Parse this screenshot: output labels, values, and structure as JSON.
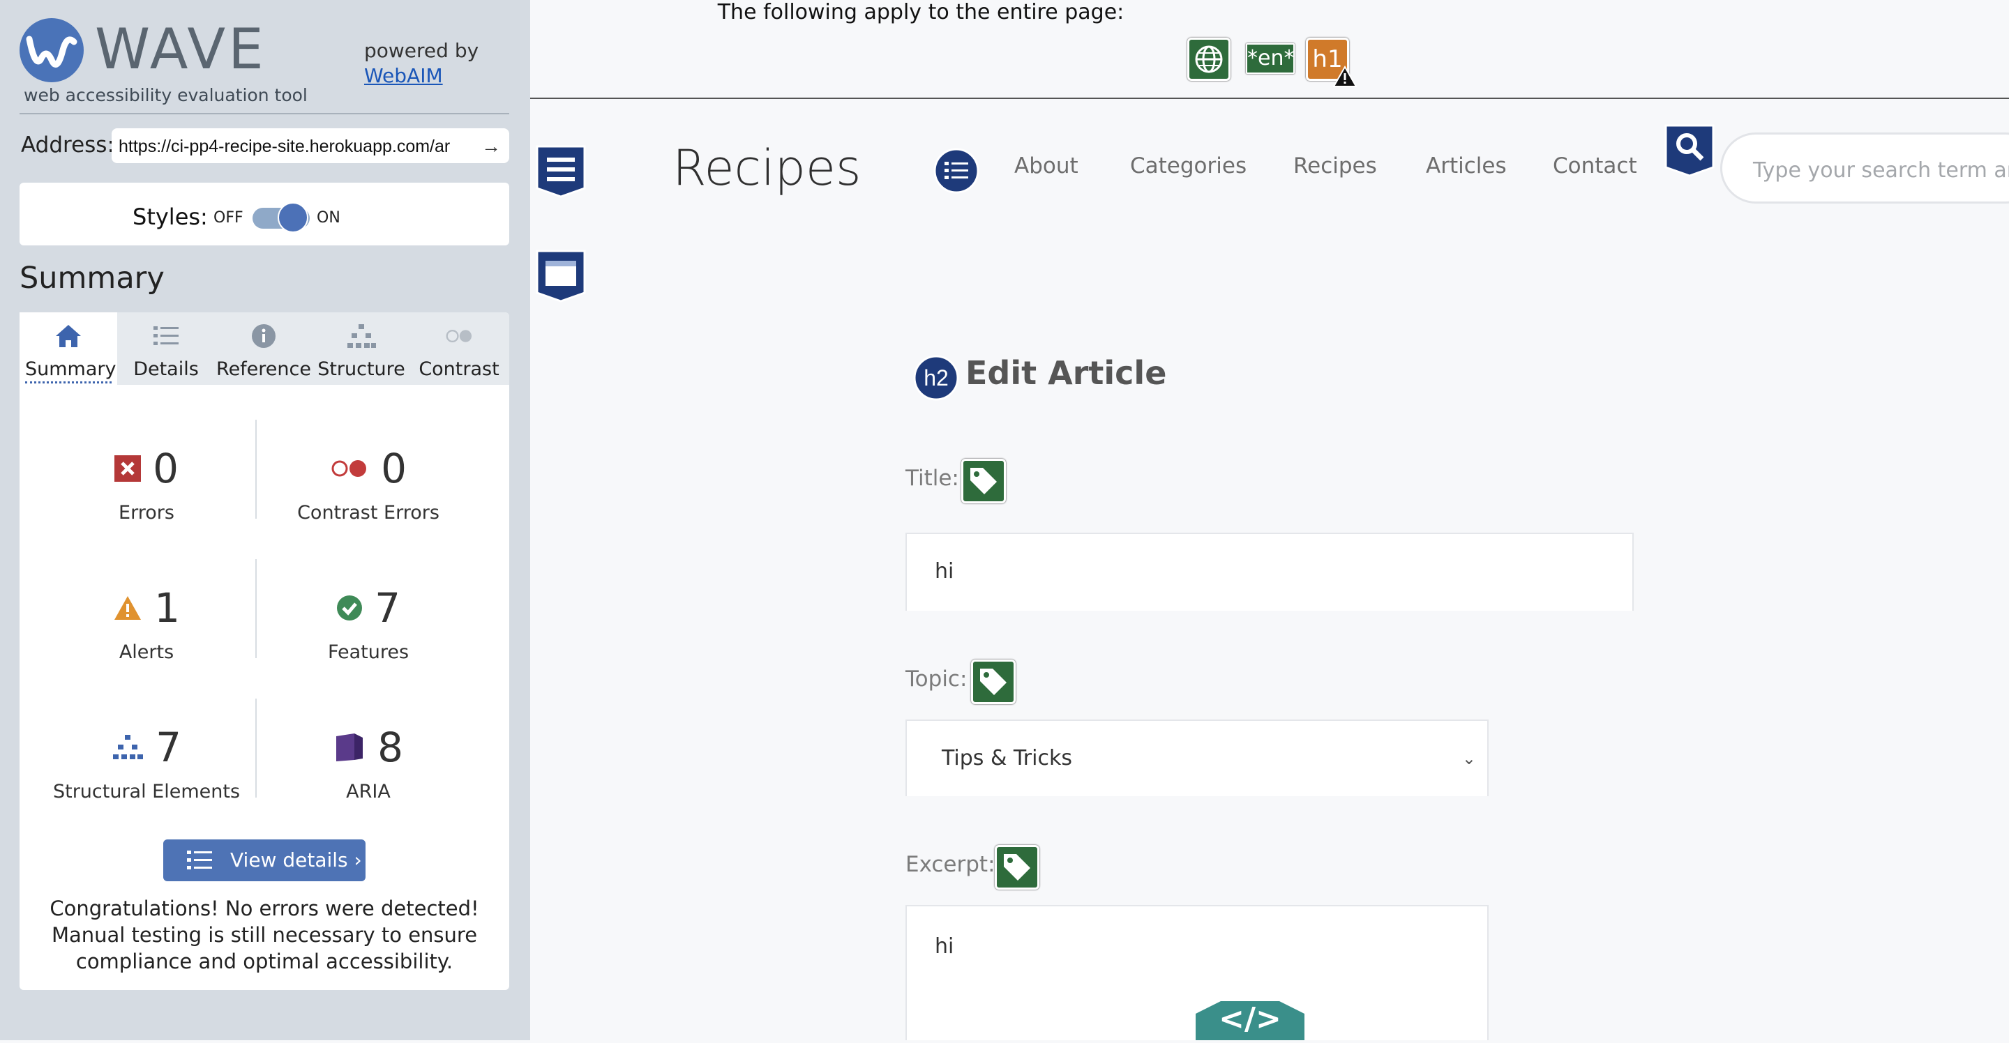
{
  "wave": {
    "logo_text": "WAVE",
    "subtitle": "web accessibility evaluation tool",
    "powered_by": "powered by",
    "webaim_link": "WebAIM",
    "address_label": "Address:",
    "address_value": "https://ci-pp4-recipe-site.herokuapp.com/ar",
    "styles_label": "Styles:",
    "styles_off": "OFF",
    "styles_on": "ON",
    "styles_toggle_state": "on",
    "summary_heading": "Summary",
    "tabs": [
      {
        "label": "Summary",
        "icon": "home-icon",
        "active": true
      },
      {
        "label": "Details",
        "icon": "list-icon",
        "active": false
      },
      {
        "label": "Reference",
        "icon": "info-icon",
        "active": false
      },
      {
        "label": "Structure",
        "icon": "hierarchy-icon",
        "active": false
      },
      {
        "label": "Contrast",
        "icon": "contrast-icon",
        "active": false
      }
    ],
    "stats": {
      "errors": {
        "count": "0",
        "label": "Errors",
        "icon": "error-icon",
        "color": "#b43838"
      },
      "contrast_errors": {
        "count": "0",
        "label": "Contrast Errors",
        "icon": "contrast-error-icon",
        "color": "#c23b3b"
      },
      "alerts": {
        "count": "1",
        "label": "Alerts",
        "icon": "alert-icon",
        "color": "#e0922f"
      },
      "features": {
        "count": "7",
        "label": "Features",
        "icon": "feature-check-icon",
        "color": "#3f8a57"
      },
      "structural": {
        "count": "7",
        "label": "Structural Elements",
        "icon": "structure-icon",
        "color": "#3d64ad"
      },
      "aria": {
        "count": "8",
        "label": "ARIA",
        "icon": "aria-icon",
        "color": "#5a3a8a"
      }
    },
    "view_details": "View details ›",
    "congrats": "Congratulations! No errors were detected! Manual testing is still necessary to ensure compliance and optimal accessibility."
  },
  "page_icons": {
    "apply_text": "The following apply to the entire page:",
    "language_badge": "*en*",
    "h1_badge": "h1"
  },
  "site": {
    "title": "Recipes",
    "nav": [
      "About",
      "Categories",
      "Recipes",
      "Articles",
      "Contact"
    ],
    "search_placeholder": "Type your search term and",
    "heading_badge": "h2",
    "form_heading": "Edit Article",
    "fields": {
      "title_label": "Title:",
      "title_value": "hi",
      "topic_label": "Topic:",
      "topic_value": "Tips & Tricks",
      "excerpt_label": "Excerpt:",
      "excerpt_value": "hi"
    },
    "code_badge": "</>"
  },
  "colors": {
    "wave_blue": "#4e73b5",
    "sidebar_bg": "#d5dbe2",
    "feature_green": "#2e6b3b",
    "alert_orange": "#d07a2a",
    "structure_navy": "#1e3a7a"
  }
}
